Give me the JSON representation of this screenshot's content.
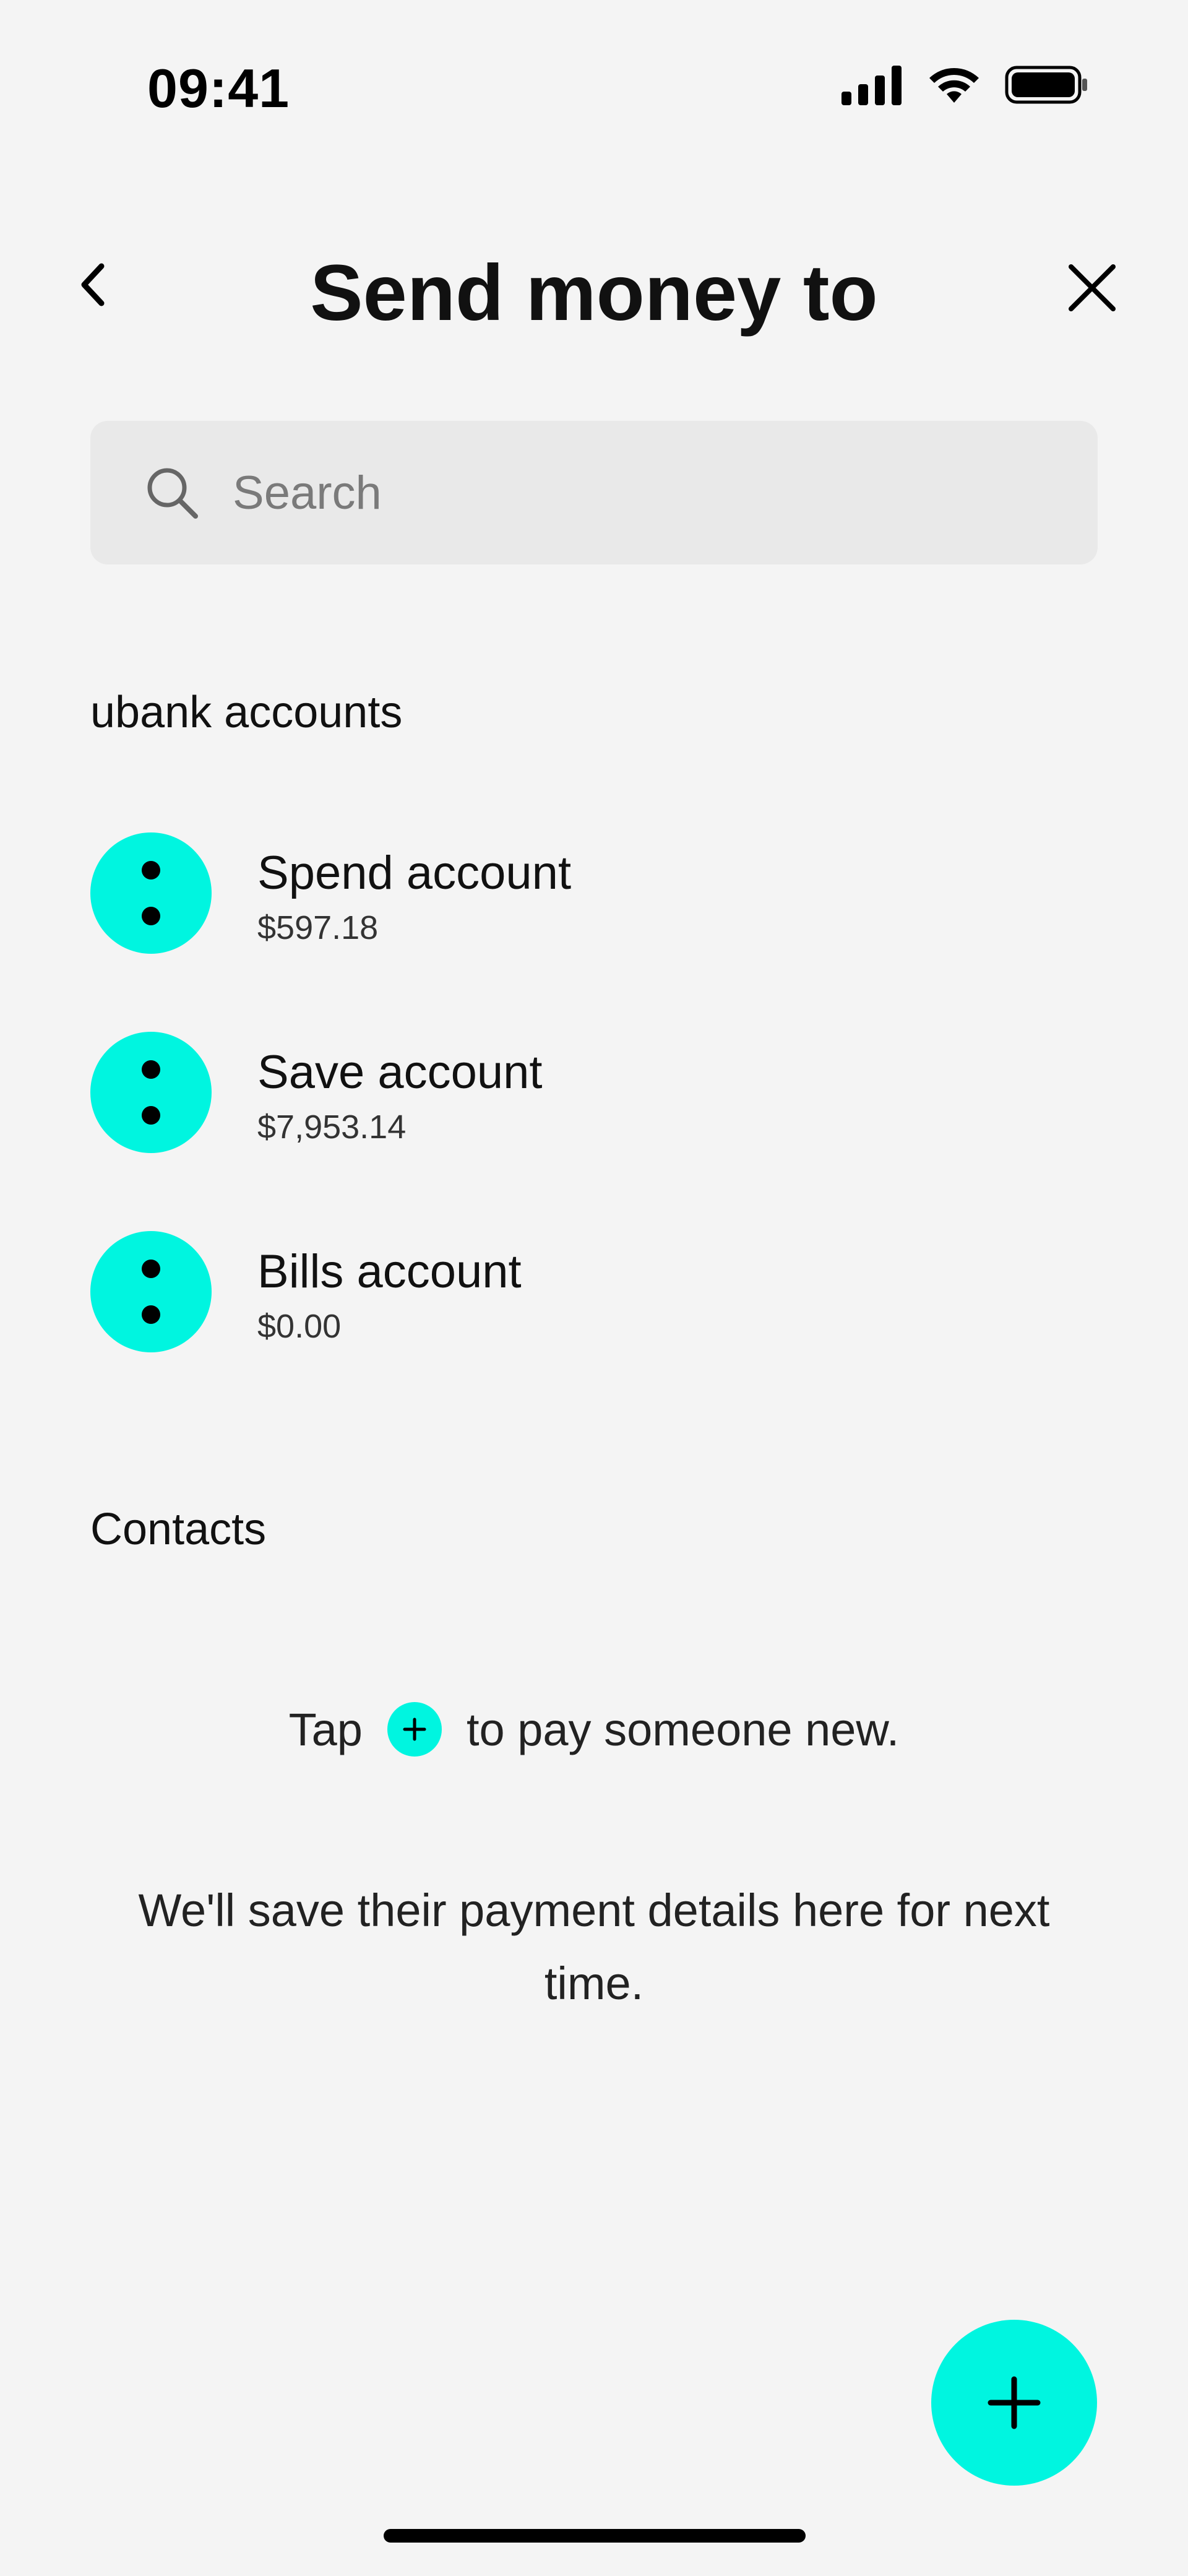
{
  "status_bar": {
    "time": "09:41",
    "icons": [
      "cellular-signal-icon",
      "wifi-icon",
      "battery-icon"
    ]
  },
  "header": {
    "title": "Send money to",
    "back_icon": "chevron-left-icon",
    "close_icon": "close-icon"
  },
  "search": {
    "placeholder": "Search",
    "value": "",
    "icon": "search-icon"
  },
  "sections": {
    "accounts_heading": "ubank accounts",
    "contacts_heading": "Contacts"
  },
  "accounts": [
    {
      "name": "Spend account",
      "balance": "$597.18",
      "icon": "more-vertical-icon"
    },
    {
      "name": "Save account",
      "balance": "$7,953.14",
      "icon": "more-vertical-icon"
    },
    {
      "name": "Bills account",
      "balance": "$0.00",
      "icon": "more-vertical-icon"
    }
  ],
  "empty_state": {
    "line1_prefix": "Tap",
    "line1_suffix": "to pay someone new.",
    "line2": "We'll save their payment details here for next time."
  },
  "fab": {
    "icon": "plus-icon"
  },
  "colors": {
    "accent": "#00f5e0",
    "background": "#f4f4f4",
    "search_background": "#e9e9e9",
    "text": "#111111"
  }
}
